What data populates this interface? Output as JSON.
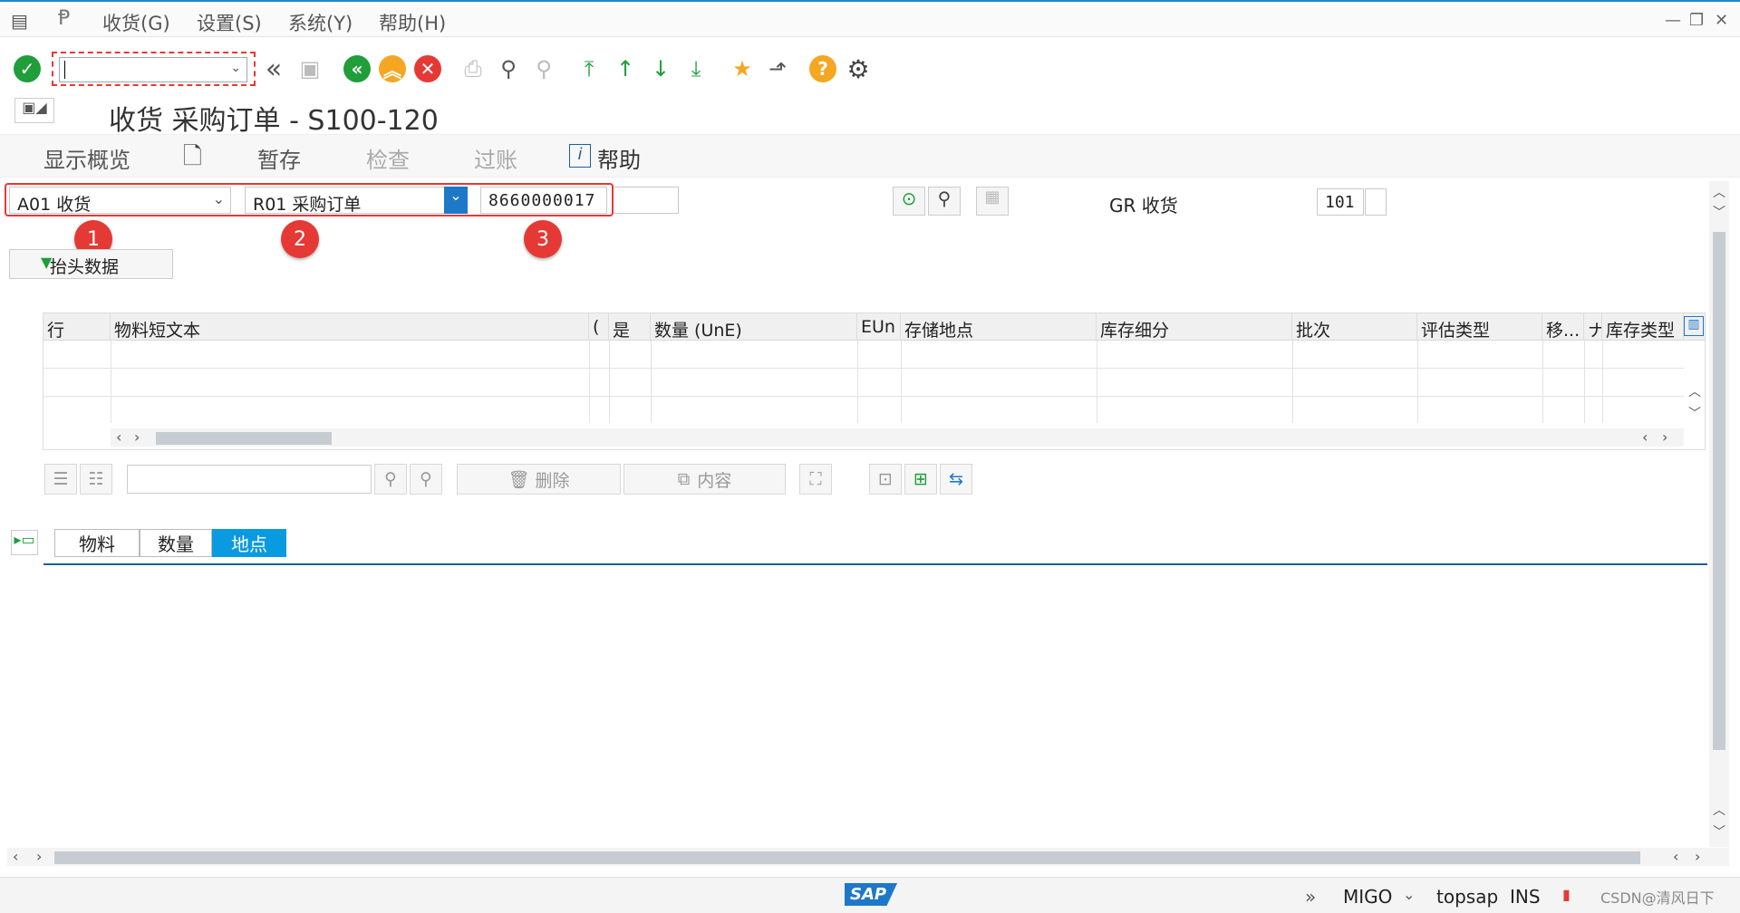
{
  "menu": {
    "items": [
      "收货(G)",
      "设置(S)",
      "系统(Y)",
      "帮助(H)"
    ]
  },
  "toolbar": {
    "command_value": "",
    "icons": [
      "check-icon",
      "back-double-icon",
      "save-icon",
      "back-icon",
      "exit-icon",
      "cancel-icon",
      "print-icon",
      "find-icon",
      "find-next-icon",
      "first-page-icon",
      "prev-page-icon",
      "next-page-icon",
      "last-page-icon",
      "new-session-icon",
      "shortcut-icon",
      "help-icon",
      "settings-icon"
    ]
  },
  "title": "收货 采购订单 - S100-120",
  "app_toolbar": {
    "overview": "显示概览",
    "hold": "暂存",
    "check": "检查",
    "post": "过账",
    "help": "帮助"
  },
  "selection": {
    "action": "A01 收货",
    "reference": "R01 采购订单",
    "po_number": "8660000017",
    "gr_label": "GR 收货",
    "movement_type": "101"
  },
  "badges": [
    "1",
    "2",
    "3"
  ],
  "header_button": "抬头数据",
  "table": {
    "columns": [
      "行",
      "物料短文本",
      "(",
      "是",
      "数量 (UnE)",
      "EUn",
      "存储地点",
      "库存细分",
      "批次",
      "评估类型",
      "移...",
      "ナ",
      "库存类型"
    ]
  },
  "grid_toolbar": {
    "delete": "删除",
    "content": "内容"
  },
  "tabs": [
    "物料",
    "数量",
    "地点"
  ],
  "status": {
    "transaction": "MIGO",
    "server": "topsap",
    "mode": "INS",
    "logo": "SAP",
    "watermark": "CSDN@清风日下"
  },
  "colors": {
    "accent": "#1e88c7",
    "active_tab": "#0a9ae0",
    "green": "#1f9e3a",
    "orange": "#f5a623",
    "red": "#e53935"
  }
}
